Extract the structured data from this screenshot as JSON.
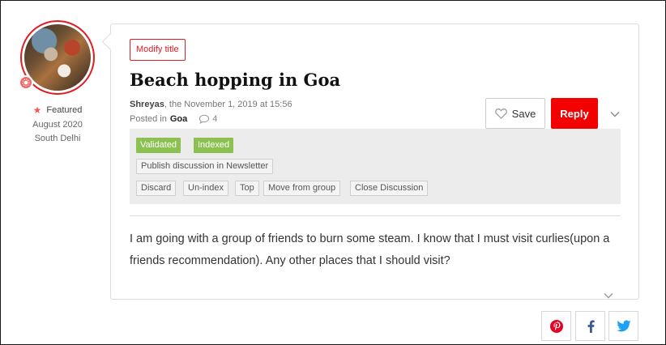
{
  "author": {
    "featured_label": "Featured",
    "joined": "August 2020",
    "location": "South Delhi"
  },
  "post": {
    "modify_title_label": "Modify title",
    "title": "Beach hopping in Goa",
    "author_name": "Shreyas",
    "date_text": ", the November 1, 2019 at 15:56",
    "posted_in_label": "Posted in",
    "group": "Goa",
    "comment_count": "4",
    "body": "I am going with a group of friends to burn some steam. I know that I must visit curlies(upon a friends recommendation). Any other places that I should visit?"
  },
  "actions": {
    "save_label": "Save",
    "reply_label": "Reply"
  },
  "admin": {
    "status_tags": [
      "Validated",
      "Indexed"
    ],
    "newsletter_label": "Publish discussion in Newsletter",
    "buttons": [
      "Discard",
      "Un-index",
      "Top",
      "Move from group",
      "Close Discussion"
    ]
  },
  "share": {
    "icons": [
      "pinterest-icon",
      "facebook-icon",
      "twitter-icon"
    ]
  },
  "colors": {
    "accent": "#f50000",
    "validated_green": "#8cc152",
    "pinterest": "#e60023",
    "facebook": "#3b5998",
    "twitter": "#1da1f2"
  }
}
